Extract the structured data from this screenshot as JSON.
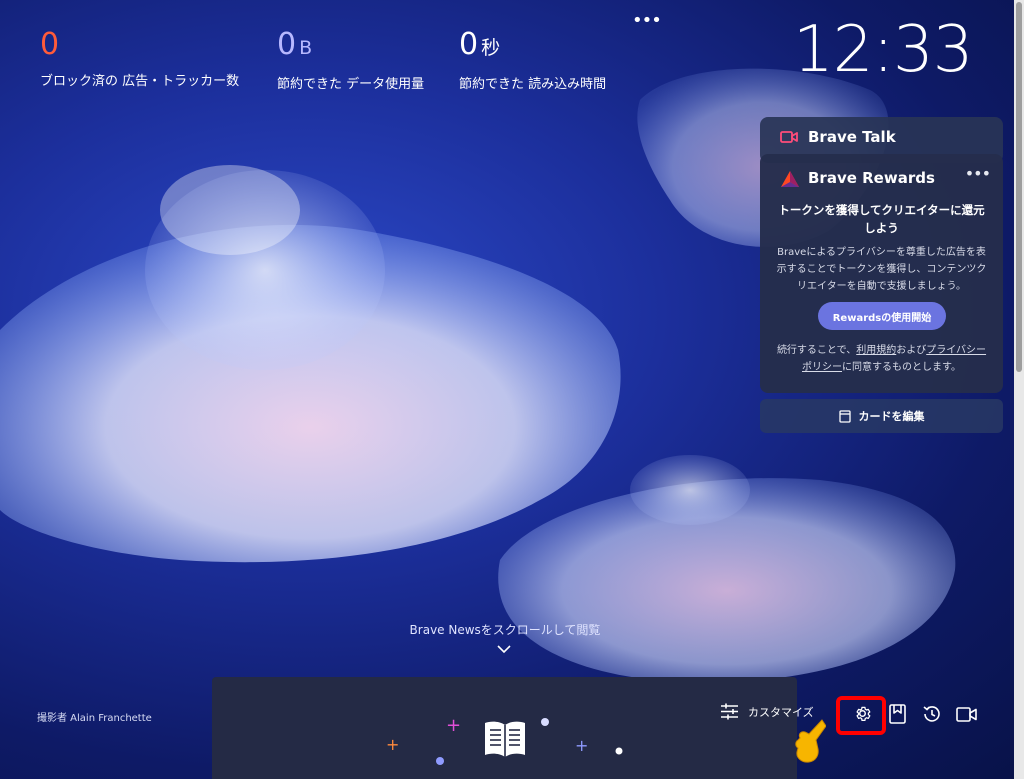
{
  "stats": {
    "ads": {
      "value": "0",
      "label": "ブロック済の 広告・トラッカー数"
    },
    "data": {
      "value": "0",
      "unit": "B",
      "label": "節約できた データ使用量"
    },
    "time": {
      "value": "0",
      "unit": "秒",
      "label": "節約できた 読み込み時間"
    }
  },
  "clock": {
    "time": "12:33"
  },
  "cards": {
    "talk": {
      "title": "Brave Talk"
    },
    "rewards": {
      "title": "Brave Rewards",
      "heading": "トークンを獲得してクリエイターに還元しよう",
      "body": "Braveによるプライバシーを尊重した広告を表示することでトークンを獲得し、コンテンツクリエイターを自動で支援しましょう。",
      "button": "Rewardsの使用開始",
      "terms_prefix": "続行することで、",
      "terms_link": "利用規約",
      "terms_mid": "および",
      "privacy_link": "プライバシーポリシー",
      "terms_suffix": "に同意するものとします。"
    },
    "edit_label": "カードを編集"
  },
  "news": {
    "hint": "Brave Newsをスクロールして閲覧"
  },
  "credit": {
    "text": "撮影者 Alain Franchette"
  },
  "toolbar": {
    "customize": "カスタマイズ"
  },
  "colors": {
    "ads": "#ff5b3a",
    "data": "#b7b8ff",
    "accent_button": "#6b74e0",
    "highlight": "#ff0000"
  }
}
